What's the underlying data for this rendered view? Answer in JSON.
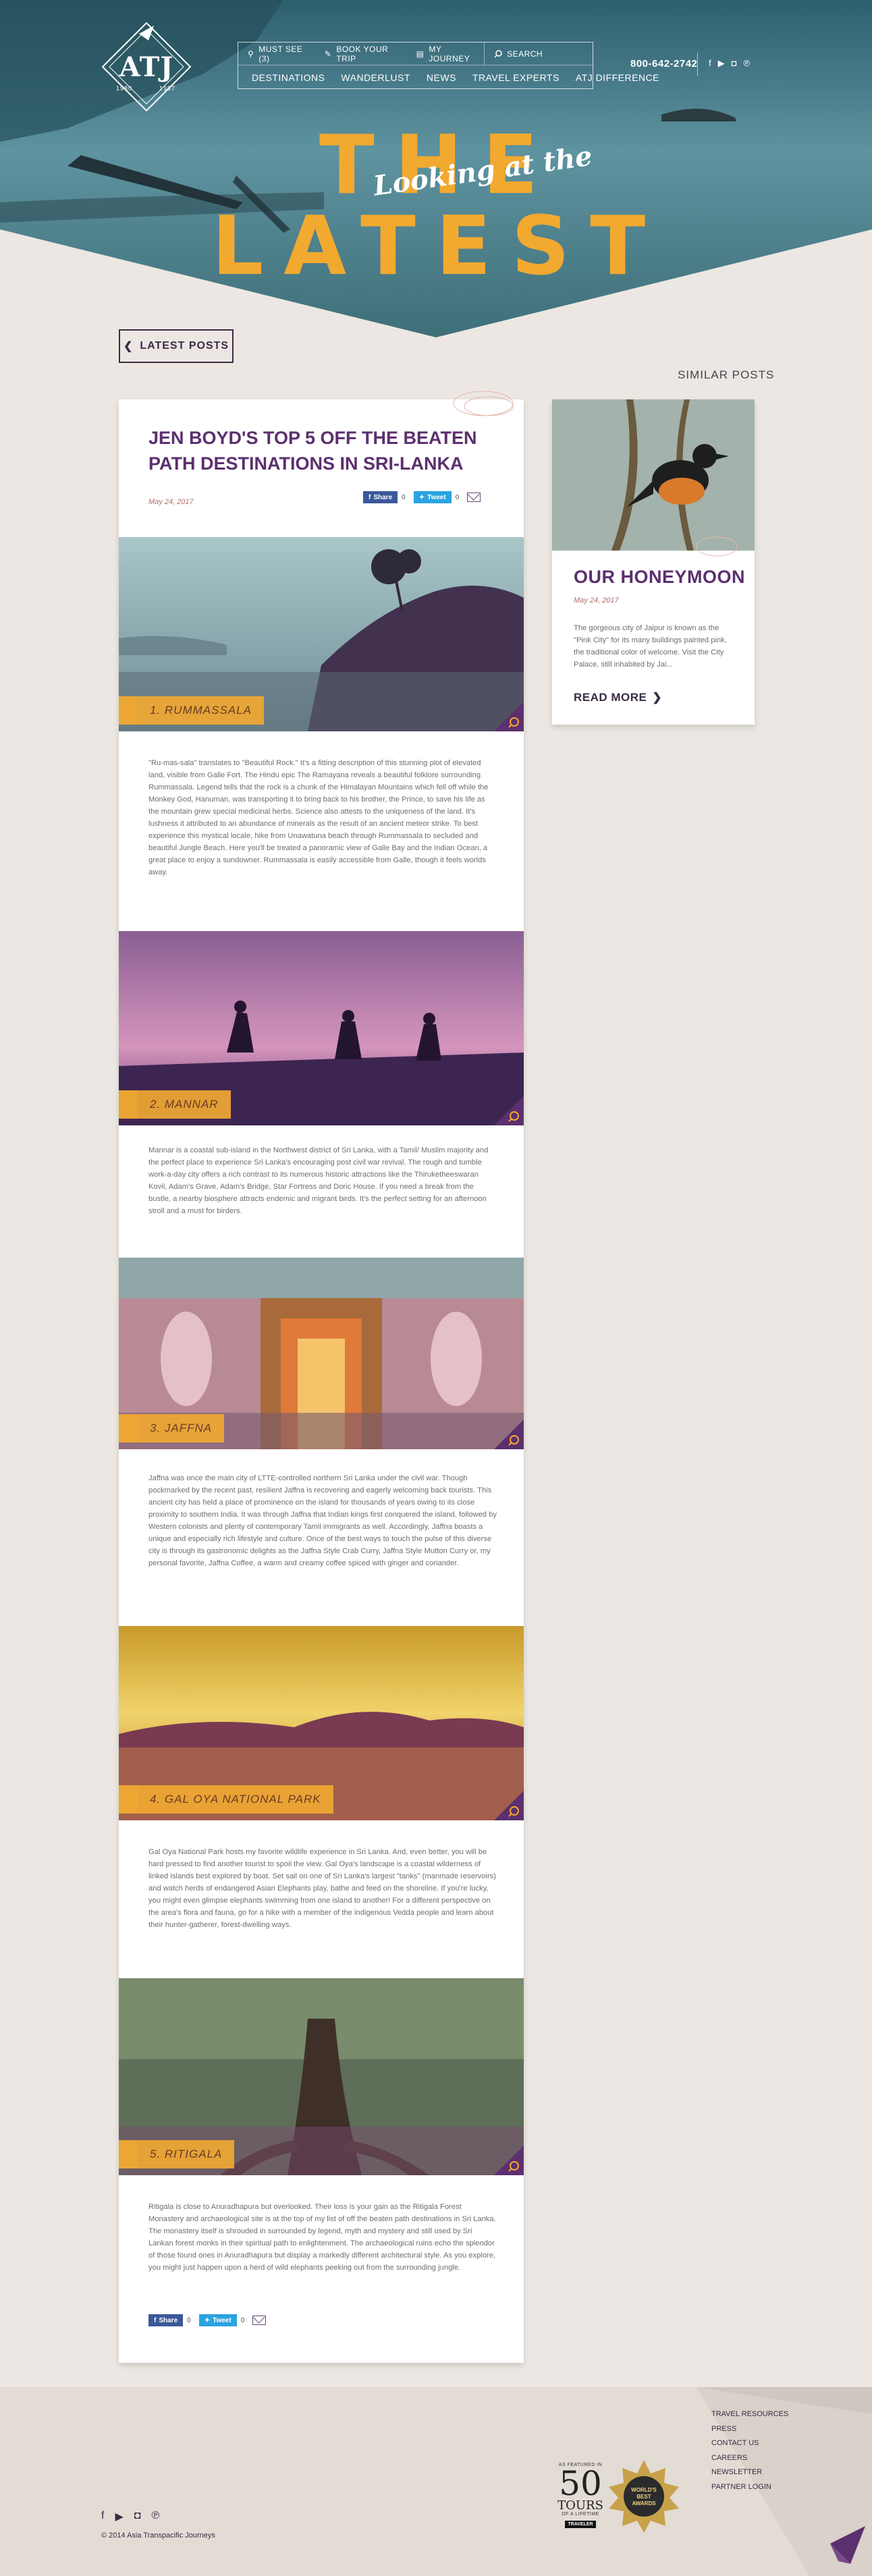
{
  "header": {
    "logo": {
      "text": "ATJ",
      "year_left": "1980",
      "year_right": "1987"
    },
    "nav_top": [
      "MUST SEE (3)",
      "BOOK YOUR TRIP",
      "MY JOURNEY"
    ],
    "search_label": "SEARCH",
    "nav_main": [
      "DESTINATIONS",
      "WANDERLUST",
      "NEWS",
      "TRAVEL EXPERTS",
      "ATJ DIFFERENCE"
    ],
    "phone": "800-642-2742",
    "social_icons": [
      "facebook-icon",
      "youtube-icon",
      "instagram-icon",
      "pinterest-icon"
    ]
  },
  "hero": {
    "title": "THE LATEST",
    "script": "Looking at the"
  },
  "back_button": "LATEST POSTS",
  "similar_heading": "SIMILAR POSTS",
  "article": {
    "title": "JEN BOYD'S TOP 5 OFF THE BEATEN PATH DESTINATIONS IN SRI-LANKA",
    "date": "May 24, 2017",
    "share": {
      "fb_label": "Share",
      "fb_count": "0",
      "tw_label": "Tweet",
      "tw_count": "0"
    },
    "sections": [
      {
        "label": "1. RUMMASSALA",
        "text": "\"Ru-mas-sala\" translates to \"Beautiful Rock.\" It's a fitting description of this stunning plot of elevated land, visible from Galle Fort. The Hindu epic The Ramayana reveals a beautiful folklore surrounding Rummassala. Legend tells that the rock is a chunk of the Himalayan Mountains which fell off while the Monkey God, Hanuman, was transporting it to bring back to his brother, the Prince, to save his life as the mountain grew special medicinal herbs. Science also attests to the uniqueness of the land. It's lushness it attributed to an abundance of minerals as the result of an ancient meteor strike. To best experience this mystical locale, hike from Unawatuna beach through Rummassala to secluded and beautiful Jungle Beach. Here you'll be treated a panoramic view of Galle Bay and the Indian Ocean, a great place to enjoy a sundowner. Rummassala is easily accessible from Galle, though it feels worlds away."
      },
      {
        "label": "2. MANNAR",
        "text": "Mannar is a coastal sub-island in the Northwest district of Sri Lanka, with a Tamil/ Muslim majority and the perfect place to experience Sri Lanka's encouraging post civil war revival. The rough and tumble work-a-day city offers a rich contrast to its numerous historic attractions like the Thiruketheeswaran Kovil, Adam's Grave, Adam's Bridge, Star Fortress and Doric House. If you need a break from the bustle, a nearby biosphere attracts endemic and migrant birds. It's the perfect setting for an afternoon stroll and a must for birders."
      },
      {
        "label": "3. JAFFNA",
        "text": "Jaffna was once the main city of LTTE-controlled northern Sri Lanka under the civil war. Though pockmarked by the recent past, resilient Jaffna is recovering and eagerly welcoming back tourists. This ancient city has held a place of prominence on the island for thousands of years owing to its close proximity to southern India. It was through Jaffna that Indian kings first conquered the island, followed by Western colonists and plenty of contemporary Tamil immigrants as well. Accordingly, Jaffna boasts a unique and especially rich lifestyle and culture. Once of the best ways to touch the pulse of this diverse city is through its gastronomic delights as the Jaffna Style Crab Curry, Jaffna Style Mutton Curry or, my personal favorite, Jaffna Coffee, a warm and creamy coffee spiced with ginger and coriander."
      },
      {
        "label": "4. GAL OYA NATIONAL PARK",
        "text": "Gal Oya National Park hosts my favorite wildlife experience in Sri Lanka. And, even better, you will be hard pressed to find another tourist to spoil the view. Gal Oya's landscape is a coastal wilderness of linked islands best explored by boat. Set sail on one of Sri Lanka's largest \"tanks\" (manmade reservoirs) and watch herds of endangered Asian Elephants play, bathe and feed on the shoreline. If you're lucky, you might even glimpse elephants swimming from one island to another! For a different perspective on the area's flora and fauna, go for a hike with a member of the indigenous Vedda people and learn about their hunter-gatherer, forest-dwelling ways."
      },
      {
        "label": "5. RITIGALA",
        "text": "Ritigala is close to Anuradhapura but overlooked. Their loss is your gain as the Ritigala Forest Monastery and archaeological site is at the top of my list of off the beaten path destinations in Sri Lanka. The monastery itself is shrouded in surrounded by legend, myth and mystery and still used by Sri Lankan forest monks in their spiritual path to enlightenment. The archaeological ruins echo the splendor of those found ones in Anuradhapura but display a markedly different architectural style. As you explore, you might just happen upon a herd of wild elephants peeking out from the surrounding jungle."
      }
    ]
  },
  "sidebar_post": {
    "title": "OUR HONEYMOON",
    "date": "May 24, 2017",
    "excerpt": "The gorgeous city of Jaipur is known as the \"Pink City\" for its many buildings painted pink, the traditional color of welcome. Visit the City Palace, still inhabited by Jai...",
    "read_more": "READ MORE"
  },
  "footer": {
    "social_icons": [
      "facebook-icon",
      "youtube-icon",
      "instagram-icon",
      "pinterest-icon"
    ],
    "copyright": "© 2014 Asia Transpacific Journeys",
    "links": [
      "TRAVEL RESOURCES",
      "PRESS",
      "CONTACT US",
      "CAREERS",
      "NEWSLETTER",
      "PARTNER LOGIN"
    ],
    "badge": {
      "featured": "AS FEATURED IN",
      "number": "50",
      "tours": "TOURS",
      "sub": "OF A LIFETIME",
      "magazine": "TRAVELER"
    },
    "award": {
      "line1": "WORLD'S",
      "line2": "BEST",
      "line3": "AWARDS"
    }
  },
  "colors": {
    "accent": "#f2a930",
    "purple": "#5c2f6e",
    "dark": "#3a2b44",
    "background": "#ece7e2"
  }
}
